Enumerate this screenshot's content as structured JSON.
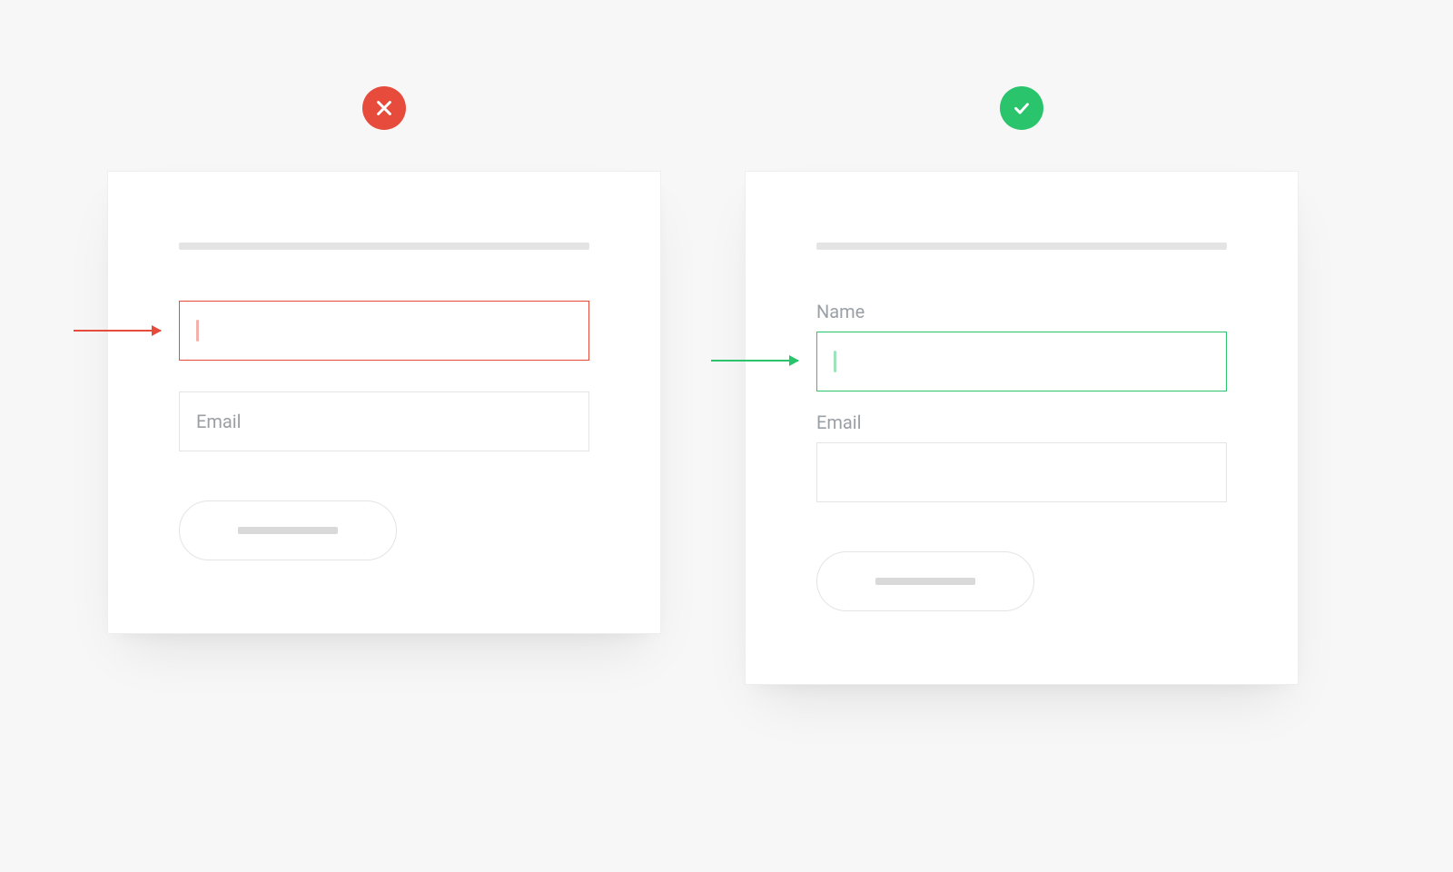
{
  "colors": {
    "error": "#e64b3c",
    "success": "#29c46b"
  },
  "bad_example": {
    "fields": {
      "name": {
        "placeholder": "",
        "focused": true
      },
      "email": {
        "placeholder": "Email",
        "focused": false
      }
    }
  },
  "good_example": {
    "fields": {
      "name": {
        "label": "Name",
        "focused": true
      },
      "email": {
        "label": "Email",
        "focused": false
      }
    }
  }
}
